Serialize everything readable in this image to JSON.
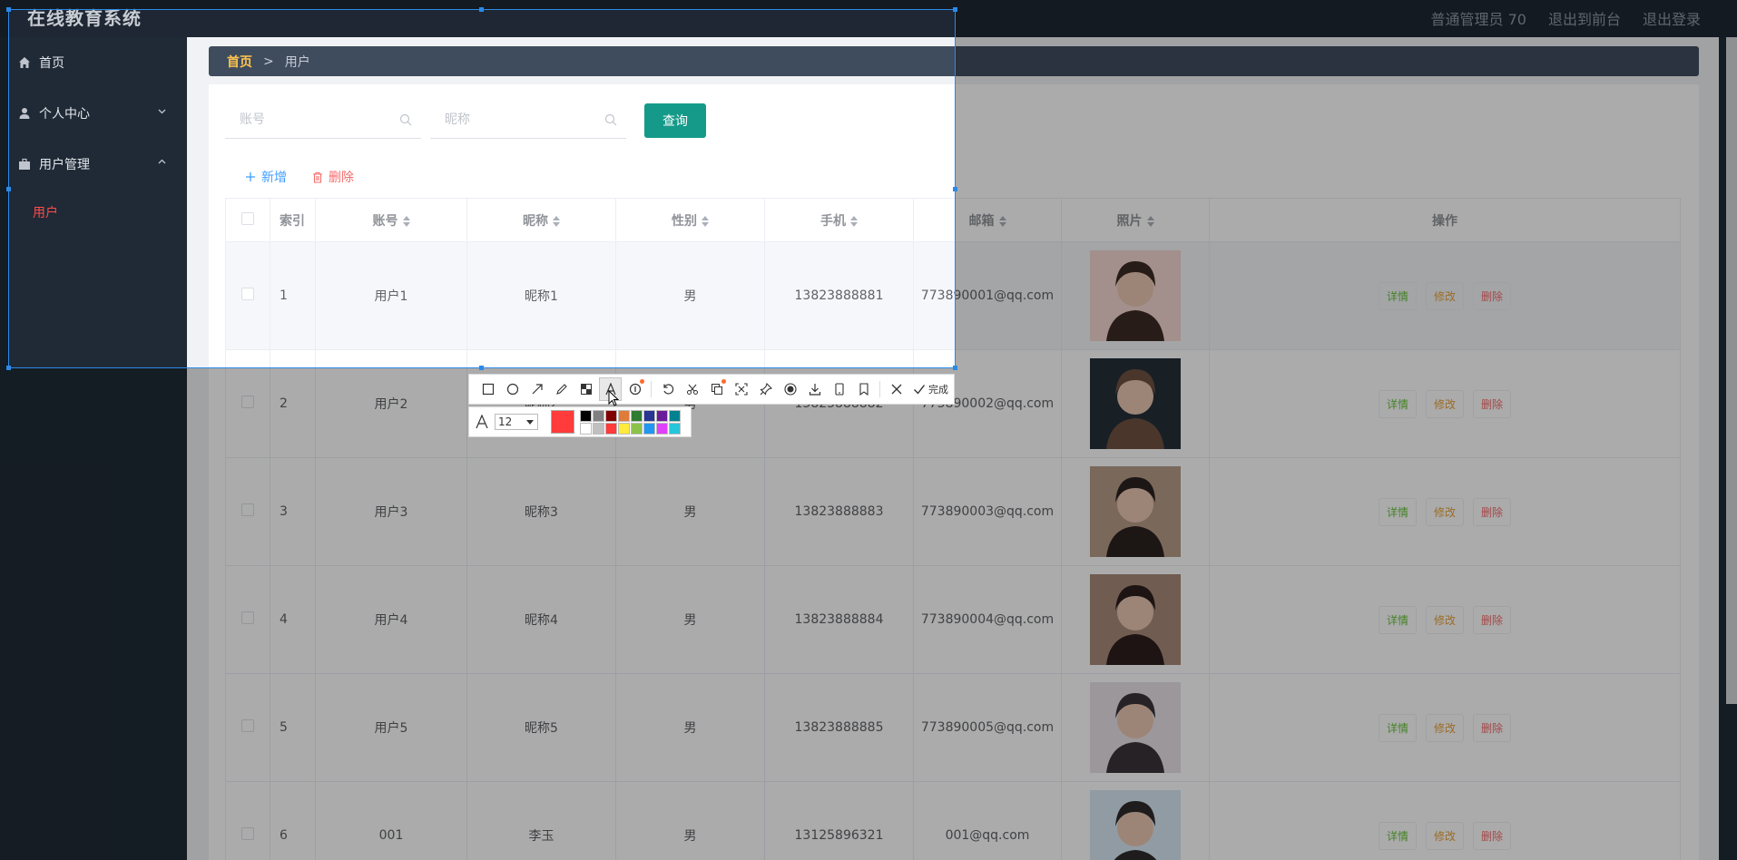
{
  "app": {
    "title": "在线教育系统"
  },
  "header": {
    "user": "普通管理员 70",
    "to_front": "退出到前台",
    "logout": "退出登录"
  },
  "sidebar": {
    "items": [
      {
        "label": "首页",
        "icon": "home-icon"
      },
      {
        "label": "个人中心",
        "icon": "user-icon",
        "arrow": "chevron-down-icon"
      },
      {
        "label": "用户管理",
        "icon": "briefcase-icon",
        "arrow": "chevron-up-icon"
      }
    ],
    "sub_items": [
      {
        "label": "用户"
      }
    ]
  },
  "breadcrumb": {
    "home": "首页",
    "separator": ">",
    "current": "用户"
  },
  "search": {
    "account_placeholder": "账号",
    "nickname_placeholder": "昵称",
    "query_label": "查询"
  },
  "actions": {
    "add_label": "新增",
    "delete_label": "删除"
  },
  "table": {
    "headers": [
      "索引",
      "账号",
      "昵称",
      "性别",
      "手机",
      "邮箱",
      "照片",
      "操作"
    ],
    "rows": [
      {
        "index": "1",
        "account": "用户1",
        "nickname": "昵称1",
        "gender": "男",
        "phone": "13823888881",
        "email": "773890001@qq.com"
      },
      {
        "index": "2",
        "account": "用户2",
        "nickname": "昵称2",
        "gender": "男",
        "phone": "13823888882",
        "email": "773890002@qq.com"
      },
      {
        "index": "3",
        "account": "用户3",
        "nickname": "昵称3",
        "gender": "男",
        "phone": "13823888883",
        "email": "773890003@qq.com"
      },
      {
        "index": "4",
        "account": "用户4",
        "nickname": "昵称4",
        "gender": "男",
        "phone": "13823888884",
        "email": "773890004@qq.com"
      },
      {
        "index": "5",
        "account": "用户5",
        "nickname": "昵称5",
        "gender": "男",
        "phone": "13823888885",
        "email": "773890005@qq.com"
      },
      {
        "index": "6",
        "account": "001",
        "nickname": "李玉",
        "gender": "男",
        "phone": "13125896321",
        "email": "001@qq.com"
      }
    ],
    "op_labels": {
      "detail": "详情",
      "edit": "修改",
      "remove": "删除"
    }
  },
  "screenshot_tool": {
    "done_label": "完成",
    "font_size": "12",
    "current_color": "#ff3b3b",
    "palette": [
      "#000000",
      "#808080",
      "#800000",
      "#e07b39",
      "#2e7d32",
      "#283593",
      "#6a1b9a",
      "#00838f",
      "#ffffff",
      "#c0c0c0",
      "#ff3b3b",
      "#ffeb3b",
      "#8bc34a",
      "#2196f3",
      "#e040fb",
      "#26c6da"
    ],
    "tools": [
      "rectangle-icon",
      "ellipse-icon",
      "arrow-icon",
      "pencil-icon",
      "mosaic-icon",
      "text-icon",
      "number-icon",
      "undo-icon",
      "cut-icon",
      "copy-icon",
      "ocr-icon",
      "pin-icon",
      "record-icon",
      "download-icon",
      "phone-icon",
      "bookmark-icon",
      "close-icon",
      "check-icon"
    ]
  }
}
